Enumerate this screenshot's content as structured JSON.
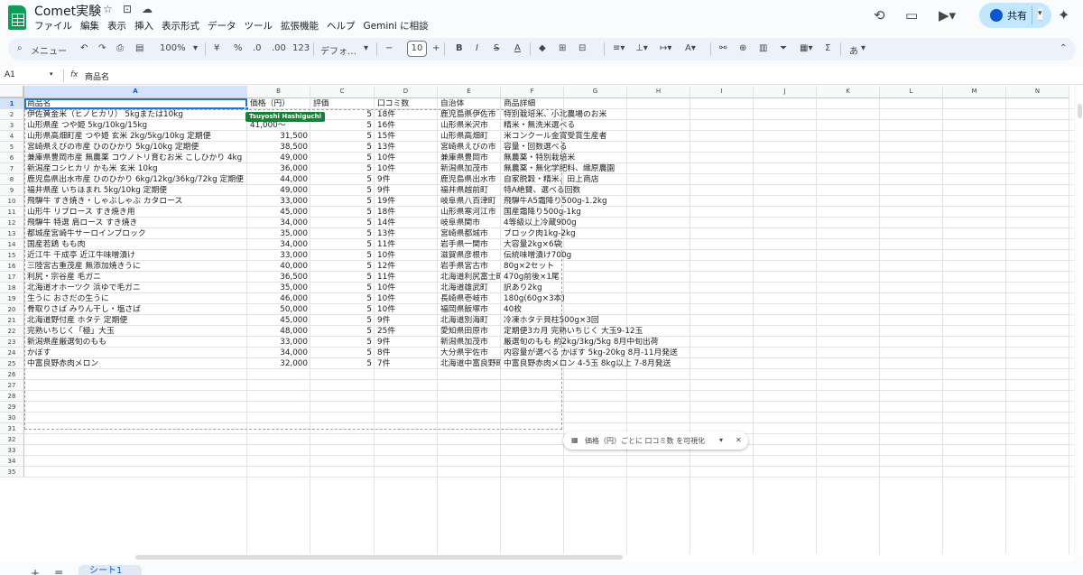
{
  "app": {
    "title": "Comet実験",
    "title_icons": {
      "star": "☆",
      "folder": "⊡",
      "cloud": "☁"
    }
  },
  "menu": [
    "ファイル",
    "編集",
    "表示",
    "挿入",
    "表示形式",
    "データ",
    "ツール",
    "拡張機能",
    "ヘルプ",
    "Gemini に相談"
  ],
  "topright": {
    "share_label": "共有"
  },
  "toolbar": {
    "search_label": "メニュー",
    "zoom": "100%",
    "currency": "¥",
    "percent": "%",
    "dec_less": ".0",
    "dec_more": ".00",
    "number_format": "123",
    "font": "デフォ…",
    "font_size": "10",
    "input_mode": "あ"
  },
  "formula": {
    "name_box": "A1",
    "fx": "fx",
    "value": "商品名"
  },
  "columns": [
    "A",
    "B",
    "C",
    "D",
    "E",
    "F",
    "G",
    "H",
    "I",
    "J",
    "K",
    "L",
    "M",
    "N"
  ],
  "rows": [
    "1",
    "2",
    "3",
    "4",
    "5",
    "6",
    "7",
    "8",
    "9",
    "10",
    "11",
    "12",
    "13",
    "14",
    "15",
    "16",
    "17",
    "18",
    "19",
    "20",
    "21",
    "22",
    "23",
    "24",
    "25",
    "26",
    "27",
    "28",
    "29",
    "30",
    "31",
    "32",
    "33",
    "34",
    "35"
  ],
  "headers": [
    "商品名",
    "価格（円）",
    "評価",
    "口コミ数",
    "自治体",
    "商品詳細"
  ],
  "table": [
    [
      "伊佐黄金米（ヒノヒカリ） 5kgまたは10kg",
      "",
      "5",
      "18件",
      "鹿児島県伊佐市",
      "特別栽培米、小北農場のお米"
    ],
    [
      "山形県産 つや姫 5kg/10kg/15kg",
      "41,000〜",
      "5",
      "16件",
      "山形県米沢市",
      "精米・無洗米選べる"
    ],
    [
      "山形県高畑町産 つや姫 玄米 2kg/5kg/10kg 定期便",
      "31,500",
      "5",
      "15件",
      "山形県高畑町",
      "米コンクール金賞受賞生産者"
    ],
    [
      "宮崎県えびの市産 ひのひかり 5kg/10kg 定期便",
      "38,500",
      "5",
      "13件",
      "宮崎県えびの市",
      "容量・回数選べる"
    ],
    [
      "兼庫県豊岡市産 無農薬 コウノトリ育むお米 こしひかり 4kg",
      "49,000",
      "5",
      "10件",
      "兼庫県豊岡市",
      "無農薬・特別栽培米"
    ],
    [
      "新潟産コシヒカリ かも米 玄米 10kg",
      "36,000",
      "5",
      "10件",
      "新潟県加茂市",
      "無農薬・無化学肥料、織原農園"
    ],
    [
      "鹿児島県出水市産 ひのひかり 6kg/12kg/36kg/72kg 定期便",
      "44,000",
      "5",
      "9件",
      "鹿児島県出水市",
      "自家脱穀・精米、田上商店"
    ],
    [
      "福井県産 いちほまれ 5kg/10kg 定期便",
      "49,000",
      "5",
      "9件",
      "福井県越前町",
      "特A絶賛、選べる回数"
    ],
    [
      "飛騨牛 すき焼き・しゃぶしゃぶ カタロース",
      "33,000",
      "5",
      "19件",
      "岐阜県八百津町",
      "飛騨牛A5霜降り500g-1.2kg"
    ],
    [
      "山形牛 リブロース すき焼き用",
      "45,000",
      "5",
      "18件",
      "山形県寒河江市",
      "国産霜降り500g-1kg"
    ],
    [
      "飛騨牛 特選 肩ロース すき焼き",
      "34,000",
      "5",
      "14件",
      "岐阜県関市",
      "4等級以上冷蔵900g"
    ],
    [
      "都城産宮崎牛サーロインブロック",
      "35,000",
      "5",
      "13件",
      "宮崎県都城市",
      "ブロック肉1kg-2kg"
    ],
    [
      "国産若鶏 もも肉",
      "34,000",
      "5",
      "11件",
      "岩手県一関市",
      "大容量2kg×6袋"
    ],
    [
      "近江牛 千成亭 近江牛味噌漬け",
      "33,000",
      "5",
      "10件",
      "滋賀県彦根市",
      "伝統味噌漬け700g"
    ],
    [
      "三陸宮古重茂産 無添加焼きうに",
      "40,000",
      "5",
      "12件",
      "岩手県宮古市",
      "80g×2セット"
    ],
    [
      "利尻・宗谷産 毛ガニ",
      "36,500",
      "5",
      "11件",
      "北海道利尻富士町",
      "470g前後×1尾"
    ],
    [
      "北海道オホーツク 浜ゆで毛ガニ",
      "35,000",
      "5",
      "10件",
      "北海道雄武町",
      "訳あり2kg"
    ],
    [
      "生うに おさだの生うに",
      "46,000",
      "5",
      "10件",
      "長崎県壱岐市",
      "180g(60g×3本)"
    ],
    [
      "骨取りさば みりん干し・塩さば",
      "50,000",
      "5",
      "10件",
      "福岡県飯塚市",
      "40枚"
    ],
    [
      "北海道野付産 ホタテ 定期便",
      "45,000",
      "5",
      "9件",
      "北海道別海町",
      "冷凍ホタテ貝柱500g×3回"
    ],
    [
      "完熟いちじく「極」大玉",
      "48,000",
      "5",
      "25件",
      "愛知県田原市",
      "定期便3カ月 完熟いちじく 大玉9-12玉"
    ],
    [
      "新潟県産厳選旬のもも",
      "33,000",
      "5",
      "9件",
      "新潟県加茂市",
      "厳選旬のもも 約2kg/3kg/5kg 8月中旬出荷"
    ],
    [
      "かぼす",
      "34,000",
      "5",
      "8件",
      "大分県宇佐市",
      "内容量が選べる かぼす 5kg-20kg 8月-11月発送"
    ],
    [
      "中富良野赤肉メロン",
      "32,000",
      "5",
      "7件",
      "北海道中富良野町",
      "中富良野赤肉メロン 4-5玉 8kg以上 7-8月発送"
    ]
  ],
  "collaborator": "Tsuyoshi Hashiguchi",
  "suggestion_chip": "価格（円）ごとに 口コミ数 を可視化",
  "sheet_tab": "シート1"
}
